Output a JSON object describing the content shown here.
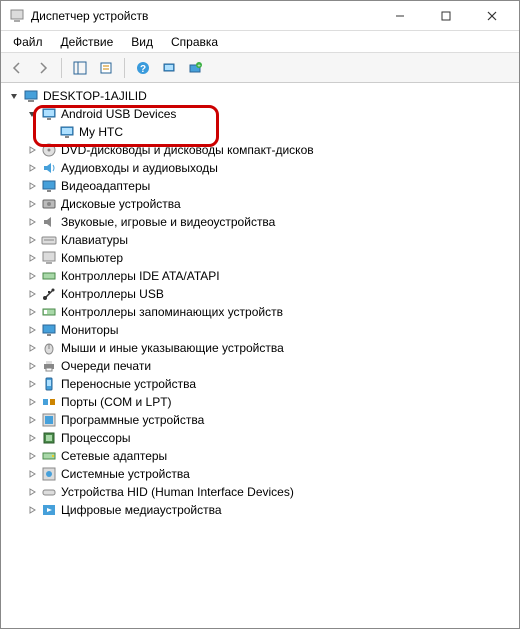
{
  "window": {
    "title": "Диспетчер устройств"
  },
  "menu": {
    "file": "Файл",
    "action": "Действие",
    "view": "Вид",
    "help": "Справка"
  },
  "root": {
    "label": "DESKTOP-1AJILID"
  },
  "highlighted_group": {
    "label": "Android USB Devices",
    "child": "My HTC"
  },
  "categories": [
    "DVD-дисководы и дисководы компакт-дисков",
    "Аудиовходы и аудиовыходы",
    "Видеоадаптеры",
    "Дисковые устройства",
    "Звуковые, игровые и видеоустройства",
    "Клавиатуры",
    "Компьютер",
    "Контроллеры IDE ATA/ATAPI",
    "Контроллеры USB",
    "Контроллеры запоминающих устройств",
    "Мониторы",
    "Мыши и иные указывающие устройства",
    "Очереди печати",
    "Переносные устройства",
    "Порты (COM и LPT)",
    "Программные устройства",
    "Процессоры",
    "Сетевые адаптеры",
    "Системные устройства",
    "Устройства HID (Human Interface Devices)",
    "Цифровые медиаустройства"
  ],
  "icons": {
    "categories": [
      "disc",
      "audio",
      "display",
      "disk",
      "sound",
      "keyboard",
      "computer",
      "ide",
      "usb",
      "storage",
      "monitor",
      "mouse",
      "printer",
      "portable",
      "port",
      "software",
      "cpu",
      "network",
      "system",
      "hid",
      "media"
    ]
  }
}
